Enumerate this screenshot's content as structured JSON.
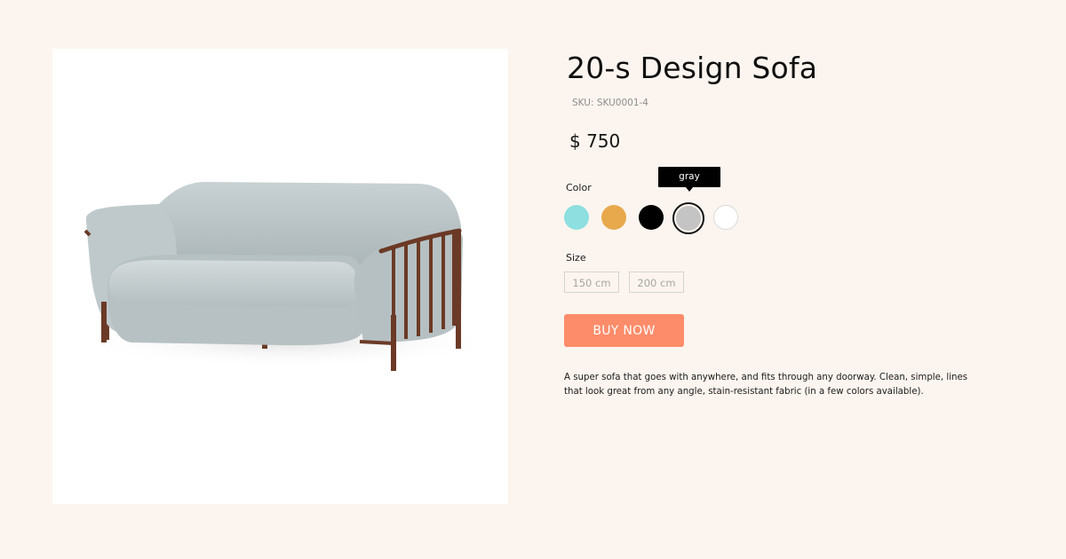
{
  "product": {
    "title": "20-s Design Sofa",
    "sku": "SKU: SKU0001-4",
    "price": "$ 750",
    "image_alt": "sofa-product-image",
    "description": "A  super sofa that goes with anywhere, and fits through any doorway. Clean, simple, lines that look great from any angle, stain-resistant fabric (in a few colors available)."
  },
  "color": {
    "label": "Color",
    "tooltip": "gray",
    "options": [
      {
        "name": "cyan",
        "hex": "#8ddfe0"
      },
      {
        "name": "orange",
        "hex": "#e8a94d"
      },
      {
        "name": "black",
        "hex": "#000000"
      },
      {
        "name": "gray",
        "hex": "#c4c4c4",
        "selected": true
      },
      {
        "name": "white",
        "hex": "#ffffff"
      }
    ]
  },
  "size": {
    "label": "Size",
    "options": [
      "150 cm",
      "200 cm"
    ]
  },
  "actions": {
    "buy_label": "BUY NOW"
  },
  "colors": {
    "background": "#fcf5ef",
    "accent": "#fd8c6a"
  }
}
